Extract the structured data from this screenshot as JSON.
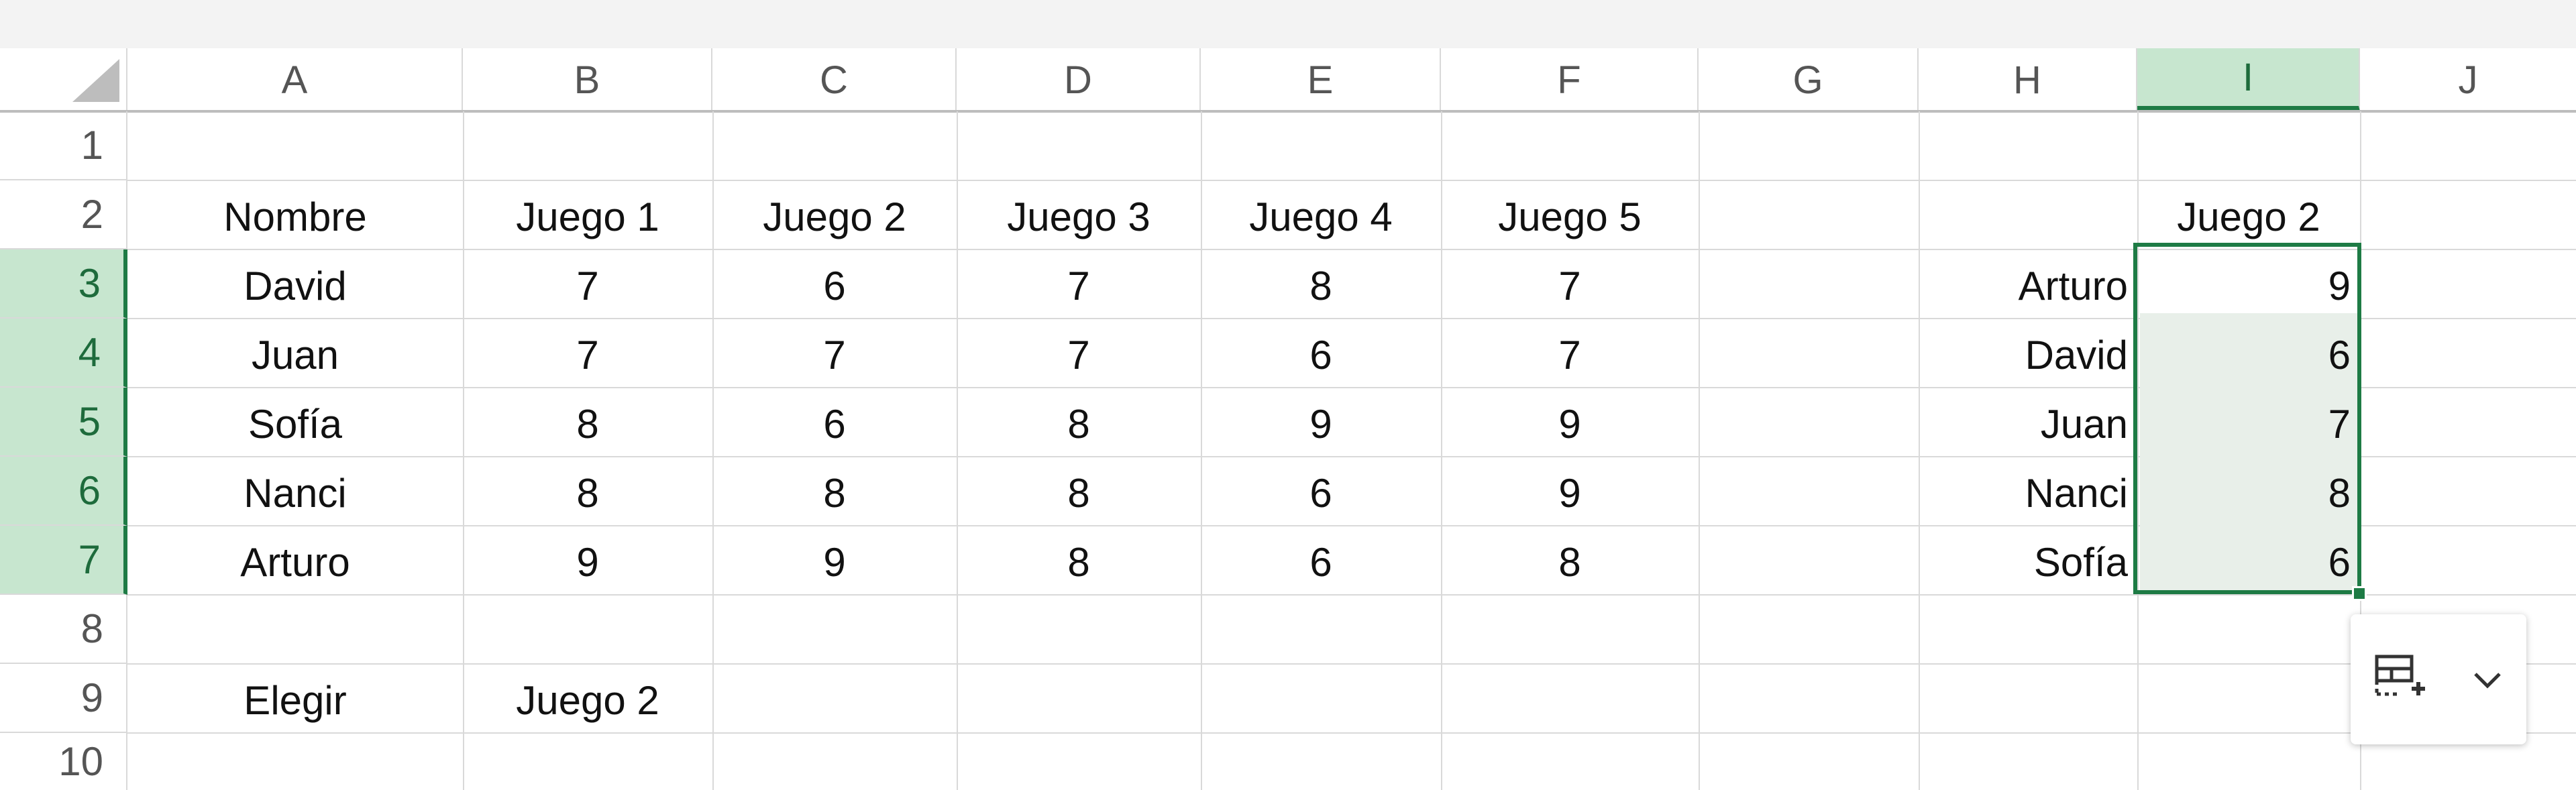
{
  "columns": [
    "A",
    "B",
    "C",
    "D",
    "E",
    "F",
    "G",
    "H",
    "I",
    "J"
  ],
  "selected_column": "I",
  "rows": [
    "1",
    "2",
    "3",
    "4",
    "5",
    "6",
    "7",
    "8",
    "9",
    "10"
  ],
  "selected_rows": [
    "3",
    "4",
    "5",
    "6",
    "7"
  ],
  "cells": {
    "A2": "Nombre",
    "B2": "Juego 1",
    "C2": "Juego 2",
    "D2": "Juego 3",
    "E2": "Juego 4",
    "F2": "Juego 5",
    "A3": "David",
    "B3": "7",
    "C3": "6",
    "D3": "7",
    "E3": "8",
    "F3": "7",
    "A4": "Juan",
    "B4": "7",
    "C4": "7",
    "D4": "7",
    "E4": "6",
    "F4": "7",
    "A5": "Sofía",
    "B5": "8",
    "C5": "6",
    "D5": "8",
    "E5": "9",
    "F5": "9",
    "A6": "Nanci",
    "B6": "8",
    "C6": "8",
    "D6": "8",
    "E6": "6",
    "F6": "9",
    "A7": "Arturo",
    "B7": "9",
    "C7": "9",
    "D7": "8",
    "E7": "6",
    "F7": "8",
    "A9": "Elegir",
    "B9": "Juego 2",
    "I2": "Juego 2",
    "H3": "Arturo",
    "I3": "9",
    "H4": "David",
    "I4": "6",
    "H5": "Juan",
    "I5": "7",
    "H6": "Nanci",
    "I6": "8",
    "H7": "Sofía",
    "I7": "6"
  },
  "quick_analysis": {
    "icon": "quick-analysis-icon",
    "dropdown_icon": "chevron-down-icon"
  },
  "colors": {
    "accent": "#1e7b45",
    "selection_header": "#c7e6cf",
    "grid": "#d9d9d9"
  }
}
